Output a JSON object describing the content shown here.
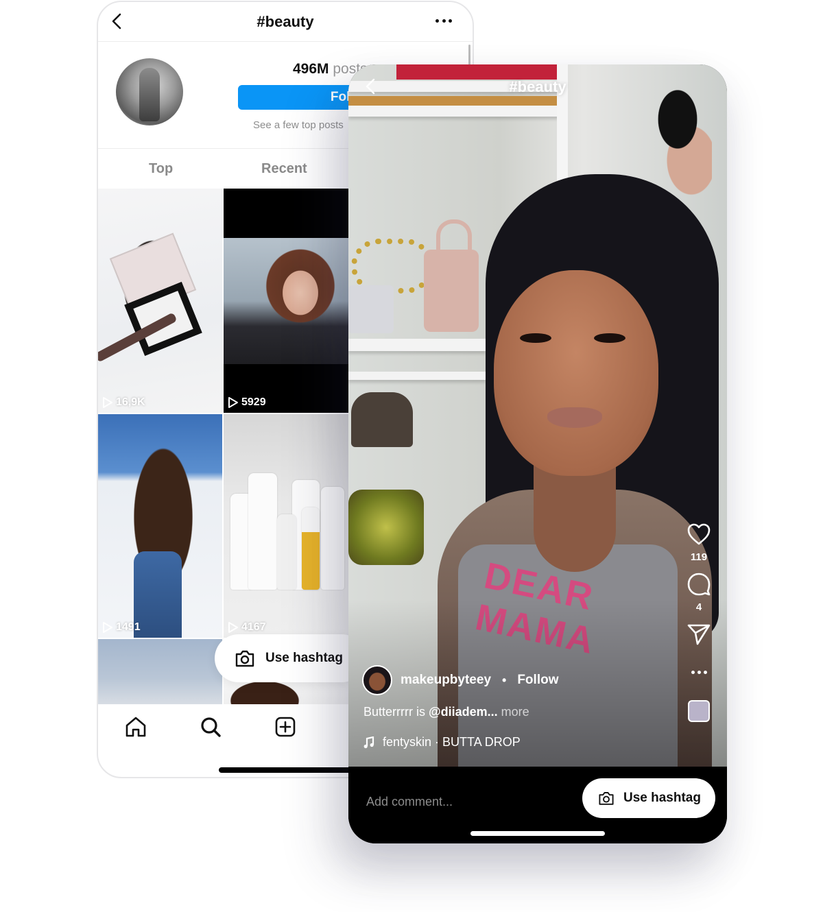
{
  "hashtag_page": {
    "title": "#beauty",
    "post_count": "496M",
    "post_count_label": "posts",
    "follow_label": "Follow",
    "see_top_text": "See a few top posts",
    "tabs": [
      {
        "label": "Top"
      },
      {
        "label": "Recent"
      }
    ],
    "grid": [
      {
        "views": "16,9K"
      },
      {
        "views": "5929"
      },
      {
        "views": "1491"
      },
      {
        "views": "4167"
      }
    ],
    "use_hashtag_label": "Use hashtag",
    "nav": [
      "home-icon",
      "search-icon",
      "add-post-icon"
    ]
  },
  "reel_viewer": {
    "title": "#beauty",
    "likes": "119",
    "comments": "4",
    "username": "makeupbyteey",
    "separator": "•",
    "follow_label": "Follow",
    "caption_prefix": "Butterrrrr is ",
    "caption_mention": "@diiadem...",
    "caption_more": " more",
    "audio": "fentyskin · BUTTA DROP",
    "shirt_text": "DEAR MAMA",
    "comment_placeholder": "Add comment...",
    "use_hashtag_label": "Use hashtag"
  }
}
